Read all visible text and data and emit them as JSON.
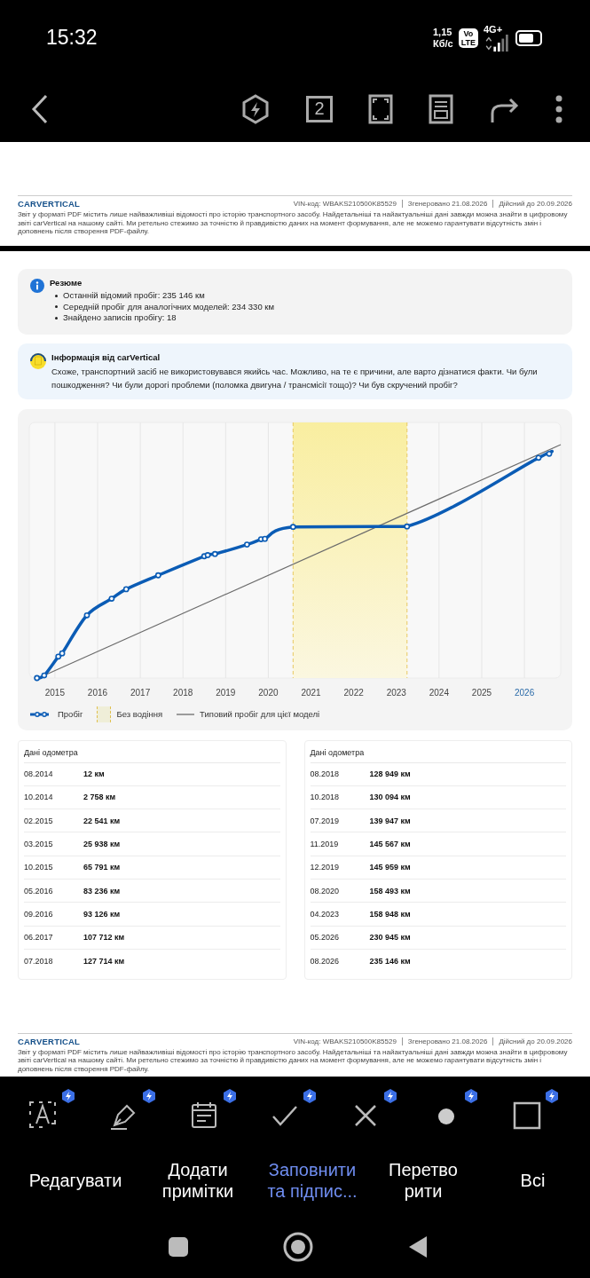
{
  "status_bar": {
    "time": "15:32",
    "speed": "1,15",
    "speed_unit": "Кб/с",
    "volte_top": "Vo",
    "volte_bottom": "LTE",
    "network": "4G+"
  },
  "toolbar": {
    "page_count": "2"
  },
  "report_footers": [
    {
      "logo": "CARVERTICAL",
      "vin": "VIN-код:  WBAKS210500K85529",
      "generated": "Згенеровано  21.08.2026",
      "valid": "Дійсний до  20.09.2026",
      "disclaimer": "Звіт у форматі PDF містить лише найважливіші відомості про історію транспортного засобу. Найдетальніші та найактуальніші дані завжди можна знайти в цифровому звіті carVertical на нашому сайті. Ми ретельно стежимо за точністю й правдивістю даних на момент формування, але не можемо гарантувати відсутність змін і доповнень після створення PDF-файлу."
    },
    {
      "logo": "CARVERTICAL",
      "vin": "VIN-код:  WBAKS210500K85529",
      "generated": "Згенеровано  21.08.2026",
      "valid": "Дійсний до  20.09.2026",
      "disclaimer": "Звіт у форматі PDF містить лише найважливіші відомості про історію транспортного засобу. Найдетальніші та найактуальніші дані завжди можна знайти в цифровому звіті carVertical на нашому сайті. Ми ретельно стежимо за точністю й правдивістю даних на момент формування, але не можемо гарантувати відсутність змін і доповнень після створення PDF-файлу."
    }
  ],
  "summary": {
    "title": "Резюме",
    "items": [
      "Останній відомий пробіг: 235 146 км",
      "Середній пробіг для аналогічних моделей: 234 330 км",
      "Знайдено записів пробігу: 18"
    ]
  },
  "info": {
    "title": "Інформація від carVertical",
    "text": "Схоже, транспортний засіб не використовувався якийсь час. Можливо, на те є причини, але варто дізнатися факти. Чи були пошкодження? Чи були дорогі проблеми (поломка двигуна / трансмісії тощо)? Чи був скручений пробіг?"
  },
  "chart": {
    "years": [
      {
        "label": "2015",
        "current": false
      },
      {
        "label": "2016",
        "current": false
      },
      {
        "label": "2017",
        "current": false
      },
      {
        "label": "2018",
        "current": false
      },
      {
        "label": "2019",
        "current": false
      },
      {
        "label": "2020",
        "current": false
      },
      {
        "label": "2021",
        "current": false
      },
      {
        "label": "2022",
        "current": false
      },
      {
        "label": "2023",
        "current": false
      },
      {
        "label": "2024",
        "current": false
      },
      {
        "label": "2025",
        "current": false
      },
      {
        "label": "2026",
        "current": true
      }
    ],
    "legend": [
      {
        "kind": "mileage",
        "label": "Пробіг"
      },
      {
        "kind": "no-driving",
        "label": "Без водіння"
      },
      {
        "kind": "typical",
        "label": "Типовий пробіг для цієї моделі"
      }
    ]
  },
  "odometer_tables": [
    {
      "title": "Дані одометра",
      "rows": [
        {
          "date": "08.2014",
          "km": "12 км"
        },
        {
          "date": "10.2014",
          "km": "2 758 км"
        },
        {
          "date": "02.2015",
          "km": "22 541 км"
        },
        {
          "date": "03.2015",
          "km": "25 938 км"
        },
        {
          "date": "10.2015",
          "km": "65 791 км"
        },
        {
          "date": "05.2016",
          "km": "83 236 км"
        },
        {
          "date": "09.2016",
          "km": "93 126 км"
        },
        {
          "date": "06.2017",
          "km": "107 712 км"
        },
        {
          "date": "07.2018",
          "km": "127 714 км"
        }
      ]
    },
    {
      "title": "Дані одометра",
      "rows": [
        {
          "date": "08.2018",
          "km": "128 949 км"
        },
        {
          "date": "10.2018",
          "km": "130 094 км"
        },
        {
          "date": "07.2019",
          "km": "139 947 км"
        },
        {
          "date": "11.2019",
          "km": "145 567 км"
        },
        {
          "date": "12.2019",
          "km": "145 959 км"
        },
        {
          "date": "08.2020",
          "km": "158 493 км"
        },
        {
          "date": "04.2023",
          "km": "158 948 км"
        },
        {
          "date": "05.2026",
          "km": "230 945 км"
        },
        {
          "date": "08.2026",
          "km": "235 146 км"
        }
      ]
    }
  ],
  "tools": [
    {
      "kind": "text"
    },
    {
      "kind": "pen"
    },
    {
      "kind": "calendar"
    },
    {
      "kind": "check"
    },
    {
      "kind": "cross"
    },
    {
      "kind": "dot"
    },
    {
      "kind": "square"
    }
  ],
  "bottom_tabs": [
    {
      "label": "Редагувати",
      "selected": false
    },
    {
      "label": "Додати\nпримітки",
      "selected": false
    },
    {
      "label": "Заповнити\nта підпис...",
      "selected": true
    },
    {
      "label": "Перетво\nрити",
      "selected": false
    },
    {
      "label": "Всі",
      "selected": false
    }
  ]
}
